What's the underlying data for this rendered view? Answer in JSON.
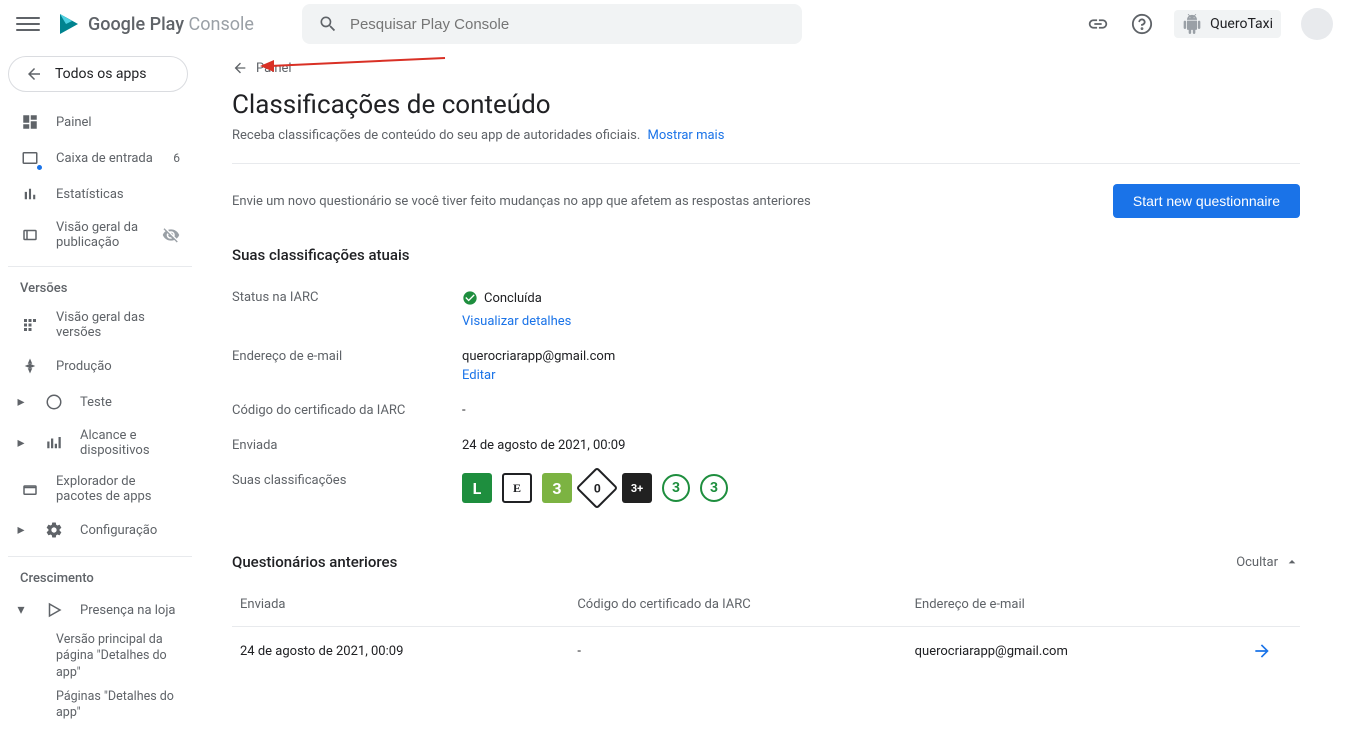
{
  "brand": {
    "google_play": "Google Play",
    "console": "Console"
  },
  "search": {
    "placeholder": "Pesquisar Play Console"
  },
  "account": {
    "app_name": "QueroTaxi"
  },
  "sidebar": {
    "all_apps": "Todos os apps",
    "items": [
      {
        "label": "Painel"
      },
      {
        "label": "Caixa de entrada",
        "badge": "6"
      },
      {
        "label": "Estatísticas"
      },
      {
        "label": "Visão geral da publicação"
      }
    ],
    "section_versions": "Versões",
    "versions": [
      {
        "label": "Visão geral das versões"
      },
      {
        "label": "Produção"
      },
      {
        "label": "Teste"
      },
      {
        "label": "Alcance e dispositivos"
      },
      {
        "label": "Explorador de pacotes de apps"
      },
      {
        "label": "Configuração"
      }
    ],
    "section_growth": "Crescimento",
    "growth": [
      {
        "label": "Presença na loja"
      }
    ],
    "growth_sub": [
      "Versão principal da página \"Detalhes do app\"",
      "Páginas \"Detalhes do app\""
    ]
  },
  "breadcrumb": {
    "back": "Painel"
  },
  "page": {
    "title": "Classificações de conteúdo",
    "subtitle": "Receba classificações de conteúdo do seu app de autoridades oficiais.",
    "show_more": "Mostrar mais",
    "hint": "Envie um novo questionário se você tiver feito mudanças no app que afetem as respostas anteriores",
    "cta": "Start new questionnaire"
  },
  "current": {
    "heading": "Suas classificações atuais",
    "status_label": "Status na IARC",
    "status_value": "Concluída",
    "view_details": "Visualizar detalhes",
    "email_label": "Endereço de e-mail",
    "email_value": "querocriarapp@gmail.com",
    "edit": "Editar",
    "cert_label": "Código do certificado da IARC",
    "cert_value": "-",
    "sent_label": "Enviada",
    "sent_value": "24 de agosto de 2021, 00:09",
    "ratings_label": "Suas classificações",
    "ratings": [
      "L",
      "E",
      "3",
      "0",
      "3+",
      "3",
      "3"
    ]
  },
  "previous": {
    "heading": "Questionários anteriores",
    "hide": "Ocultar",
    "columns": {
      "sent": "Enviada",
      "code": "Código do certificado da IARC",
      "email": "Endereço de e-mail"
    },
    "rows": [
      {
        "sent": "24 de agosto de 2021, 00:09",
        "code": "-",
        "email": "querocriarapp@gmail.com"
      }
    ]
  }
}
